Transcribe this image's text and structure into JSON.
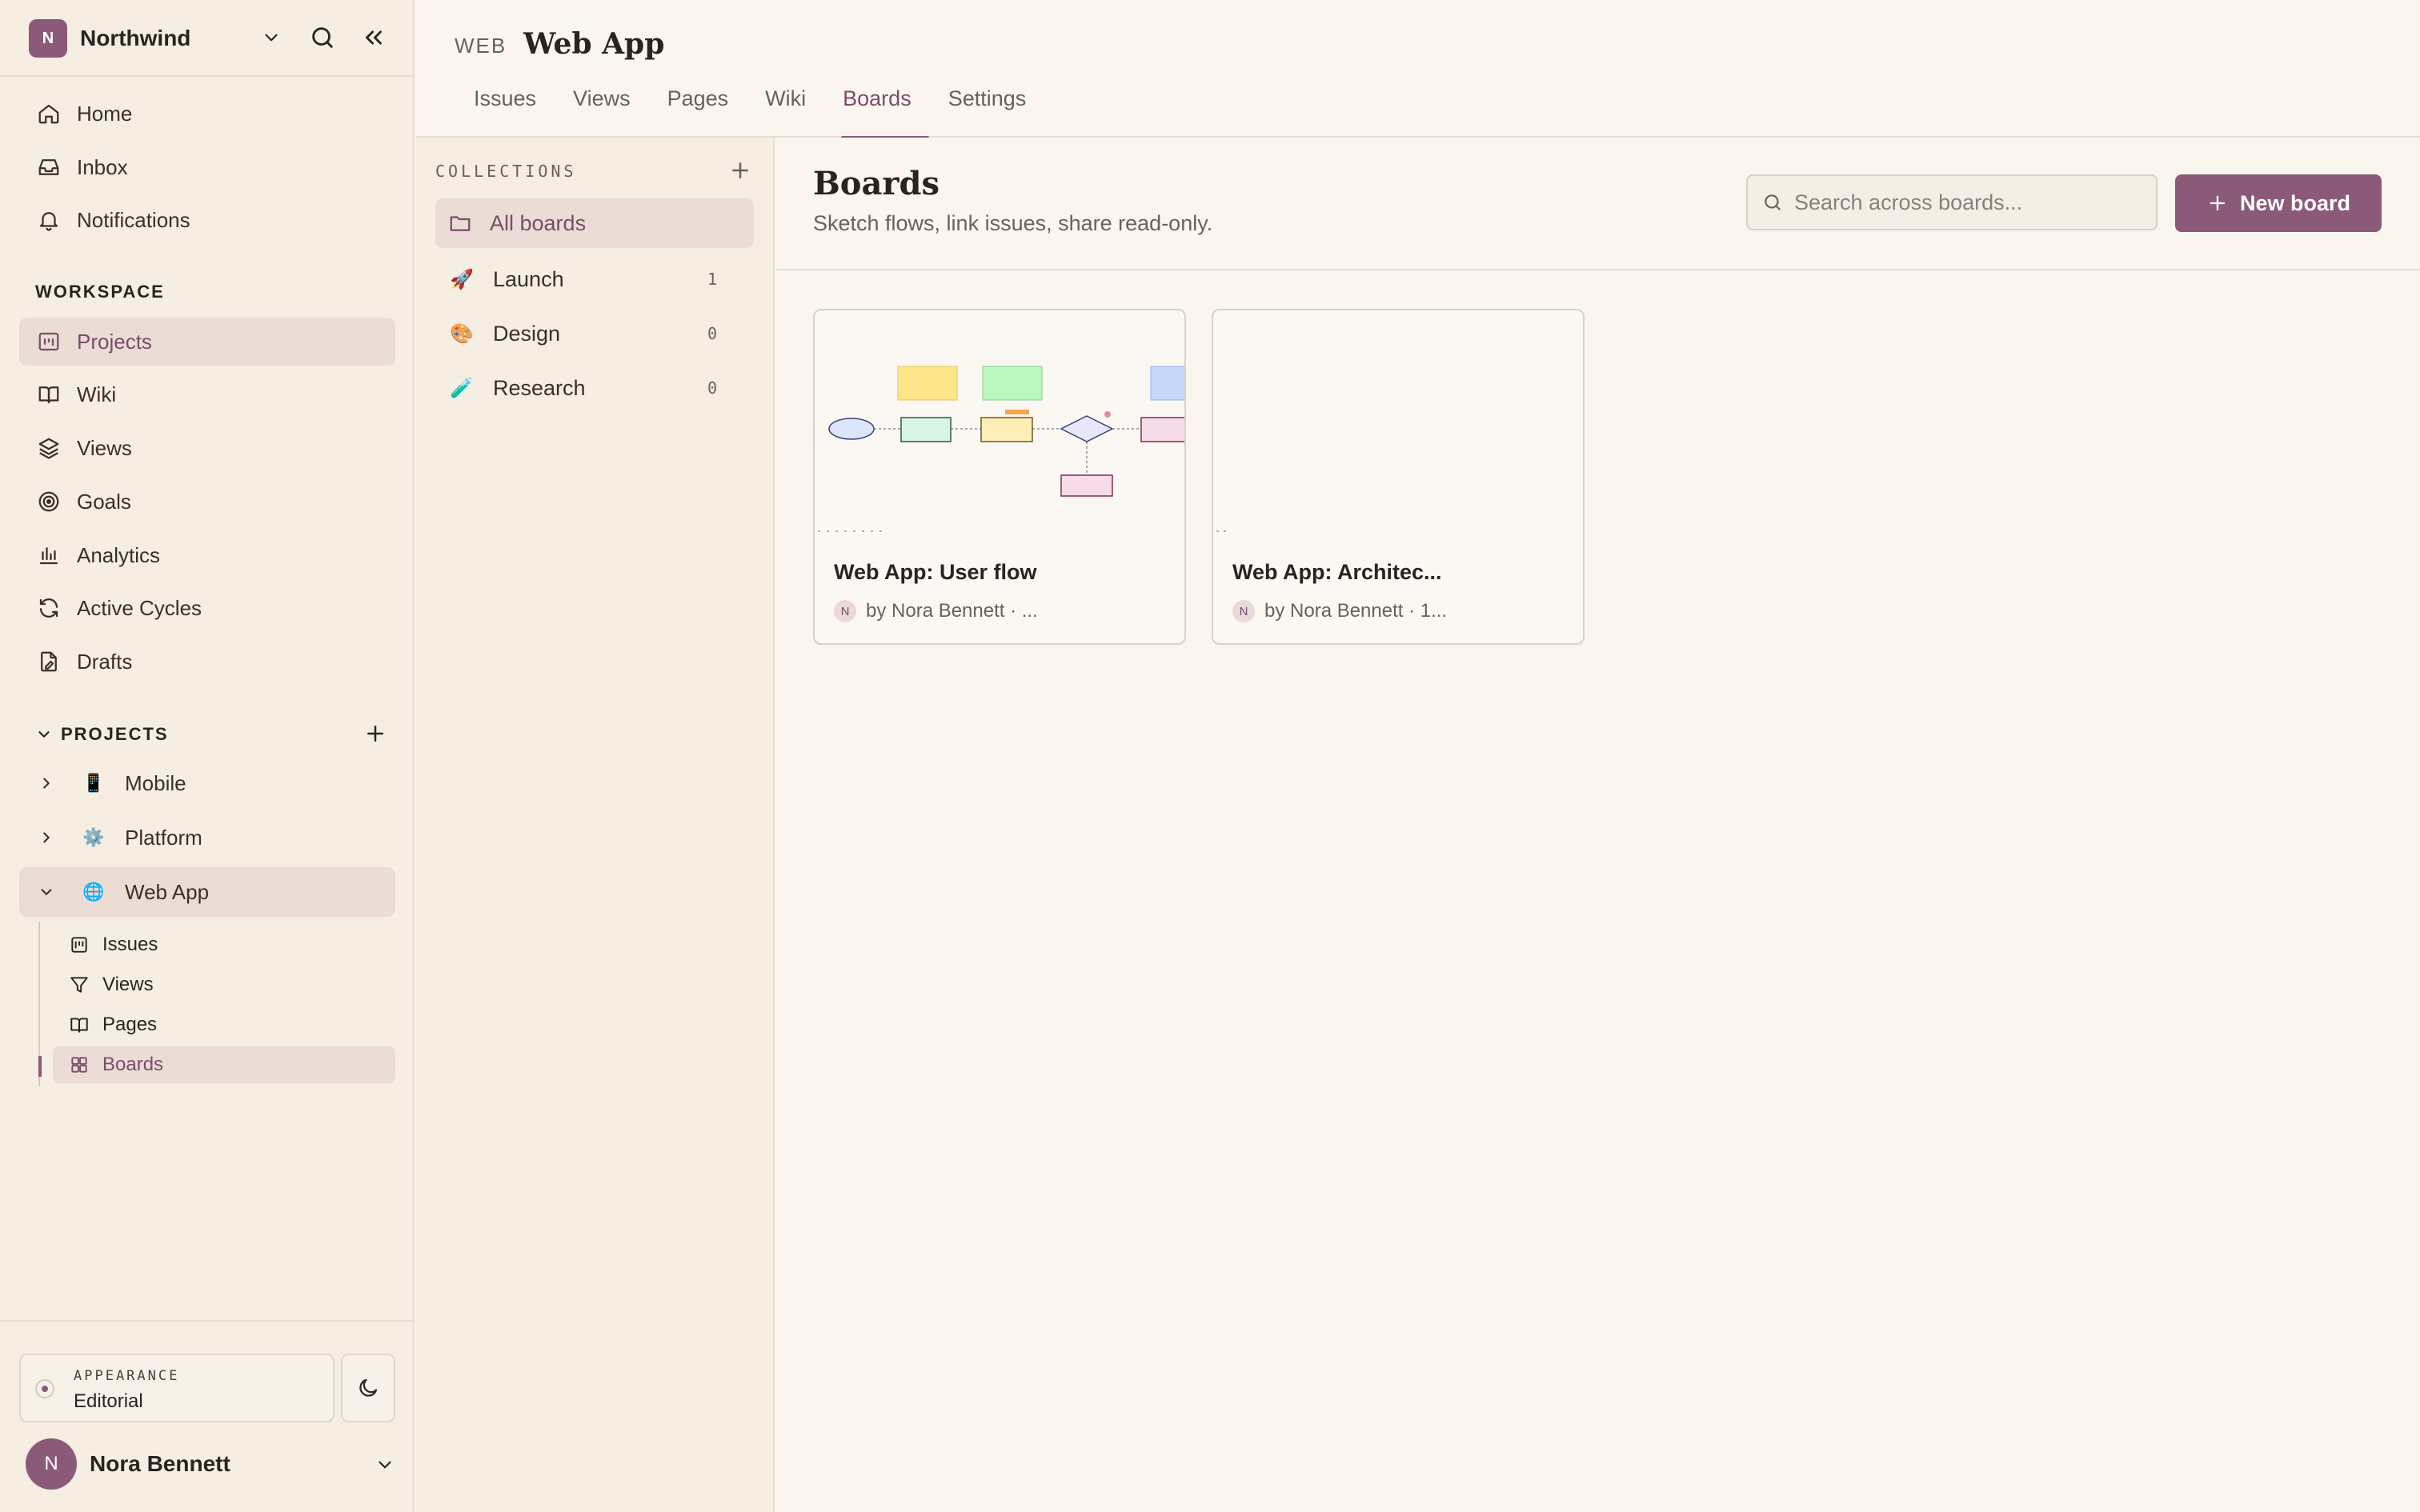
{
  "workspace": {
    "initial": "N",
    "name": "Northwind"
  },
  "nav": {
    "home": "Home",
    "inbox": "Inbox",
    "notifications": "Notifications",
    "workspace_label": "WORKSPACE",
    "projects": "Projects",
    "wiki": "Wiki",
    "views": "Views",
    "goals": "Goals",
    "analytics": "Analytics",
    "active_cycles": "Active Cycles",
    "drafts": "Drafts"
  },
  "projects": {
    "label": "PROJECTS",
    "items": [
      {
        "emoji": "📱",
        "name": "Mobile"
      },
      {
        "emoji": "⚙️",
        "name": "Platform"
      },
      {
        "emoji": "🌐",
        "name": "Web App"
      }
    ],
    "sub_items": [
      "Issues",
      "Views",
      "Pages",
      "Boards"
    ]
  },
  "appearance": {
    "caption": "APPEARANCE",
    "value": "Editorial"
  },
  "user": {
    "initial": "N",
    "name": "Nora Bennett"
  },
  "header": {
    "key": "WEB",
    "title": "Web App",
    "tabs": [
      "Issues",
      "Views",
      "Pages",
      "Wiki",
      "Boards",
      "Settings"
    ],
    "active_tab": "Boards"
  },
  "collections": {
    "heading": "COLLECTIONS",
    "items": [
      {
        "emoji": "",
        "name": "All boards",
        "count": ""
      },
      {
        "emoji": "🚀",
        "name": "Launch",
        "count": "1"
      },
      {
        "emoji": "🎨",
        "name": "Design",
        "count": "0"
      },
      {
        "emoji": "🧪",
        "name": "Research",
        "count": "0"
      }
    ]
  },
  "main": {
    "title": "Boards",
    "subtitle": "Sketch flows, link issues, share read-only.",
    "search_placeholder": "Search across boards...",
    "new_board_label": "New board",
    "cards": [
      {
        "title": "Web App: User flow",
        "author_initial": "N",
        "meta": "by Nora Bennett · ..."
      },
      {
        "title": "Web App: Architec...",
        "author_initial": "N",
        "meta": "by Nora Bennett · 1..."
      }
    ]
  },
  "colors": {
    "accent": "#8a5a78",
    "sidebar_bg": "#f6ede3",
    "page_bg": "#faf6ef",
    "active_bg": "#ecdcd6"
  }
}
